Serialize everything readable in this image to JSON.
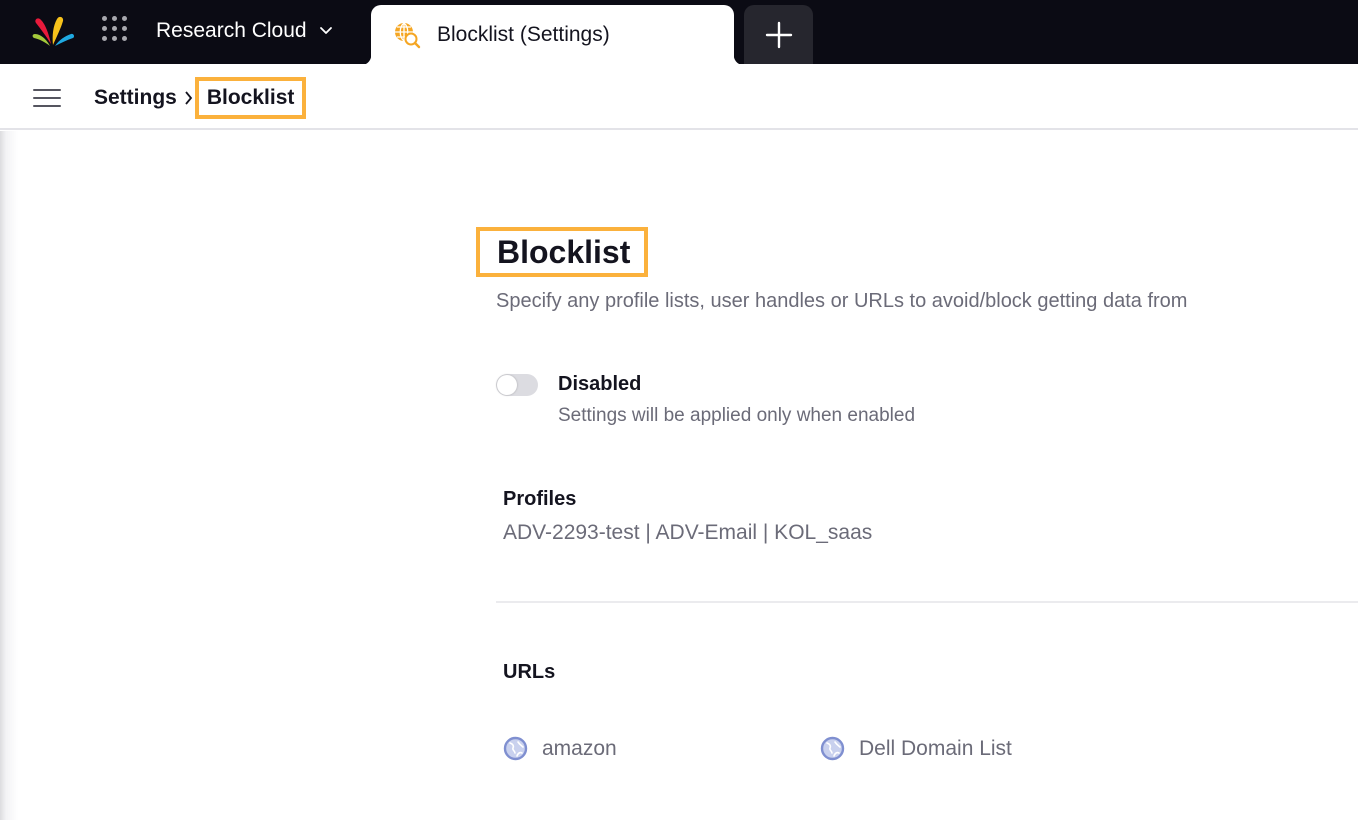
{
  "topbar": {
    "workspace_name": "Research Cloud",
    "logo_icon": "brand-logo",
    "apps_icon": "apps-grid-icon",
    "active_tab": {
      "label": "Blocklist (Settings)",
      "icon": "globe-search-icon"
    },
    "new_tab_icon": "plus-icon"
  },
  "breadcrumb": {
    "menu_icon": "hamburger-icon",
    "items": [
      {
        "label": "Settings"
      },
      {
        "label": "Blocklist"
      }
    ]
  },
  "page": {
    "title": "Blocklist",
    "description": "Specify any profile lists, user handles or URLs to avoid/block getting data from",
    "toggle": {
      "state": "off",
      "label": "Disabled",
      "hint": "Settings will be applied only when enabled"
    },
    "profiles": {
      "label": "Profiles",
      "value": "ADV-2293-test | ADV-Email | KOL_saas"
    },
    "urls": {
      "label": "URLs",
      "items": [
        {
          "label": "amazon",
          "icon": "globe-icon"
        },
        {
          "label": "Dell Domain List",
          "icon": "globe-icon"
        }
      ]
    }
  },
  "colors": {
    "topbar_bg": "#0b0b14",
    "highlight": "#fbb13c",
    "muted_text": "#6b6b78",
    "tab_icon": "#f5a623",
    "globe": "#7f8fd0"
  }
}
